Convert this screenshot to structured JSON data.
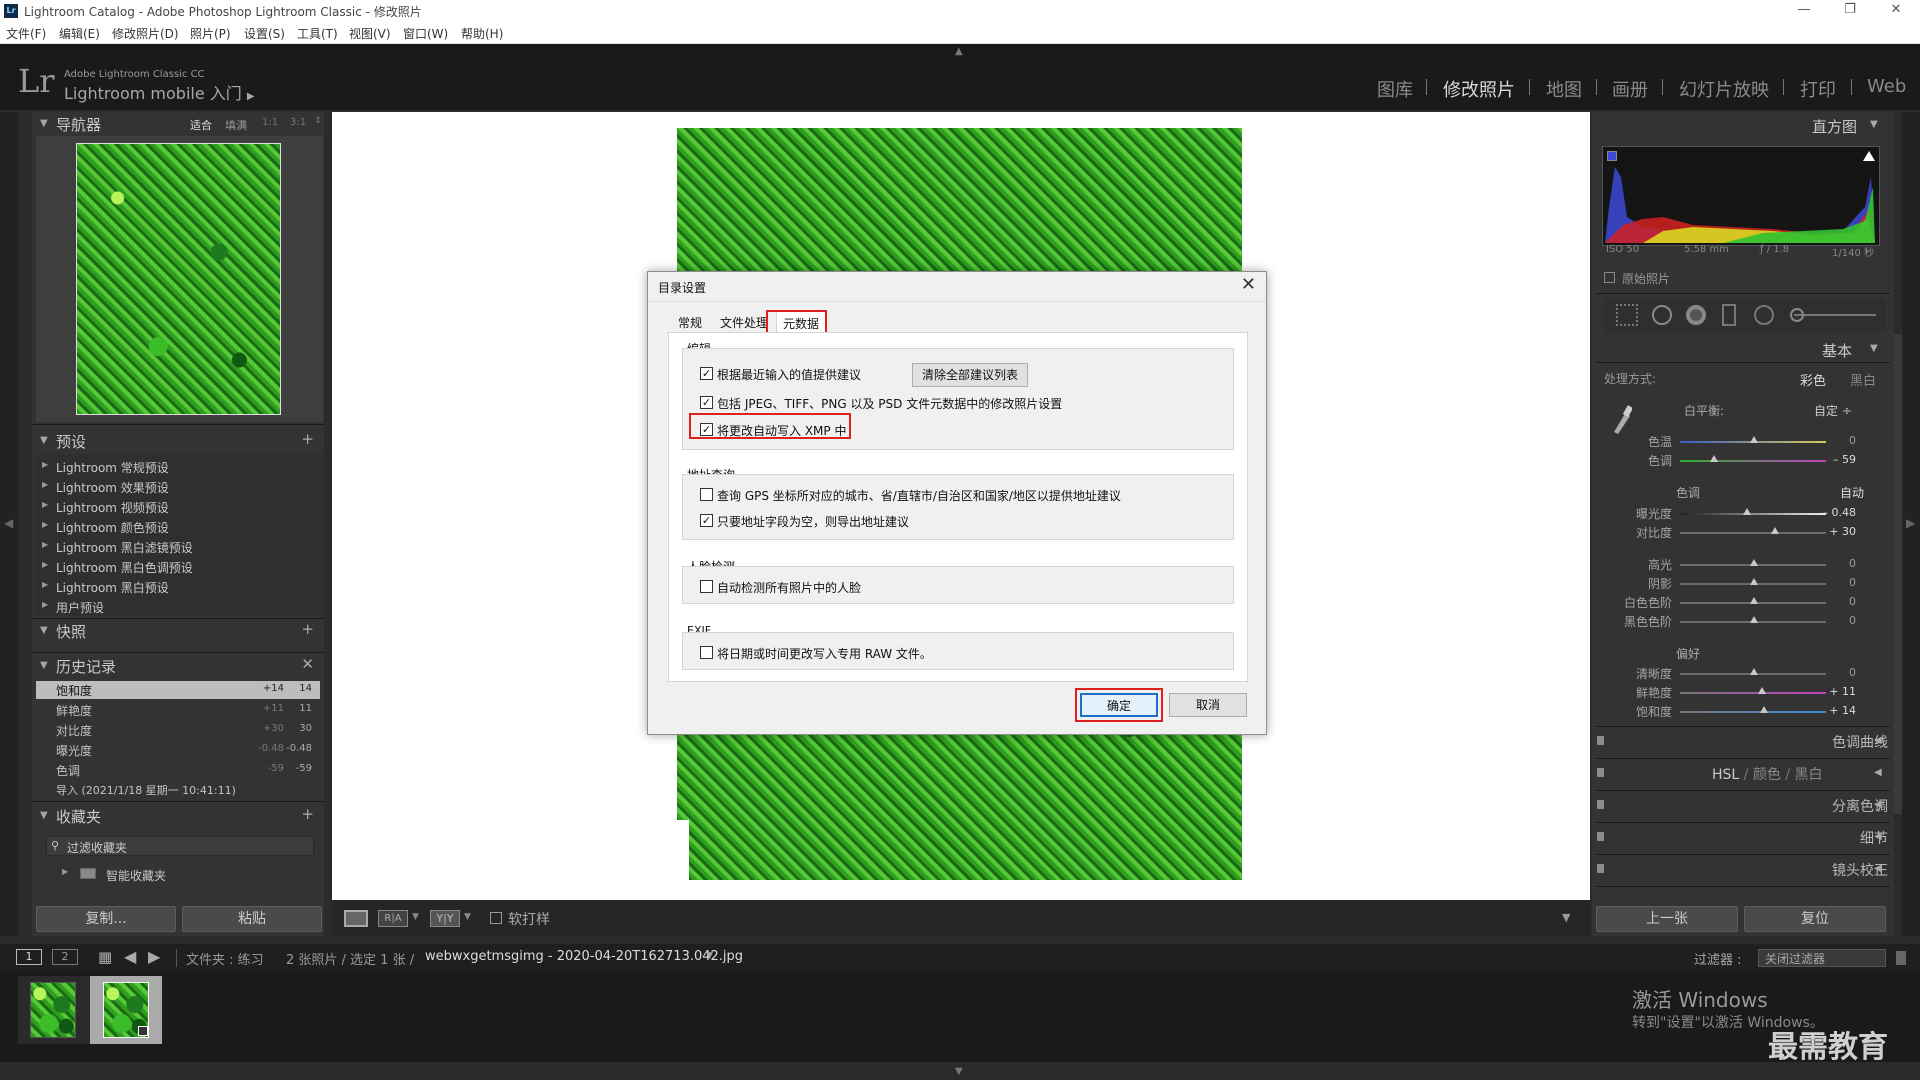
{
  "window": {
    "title": "Lightroom Catalog - Adobe Photoshop Lightroom Classic - 修改照片",
    "app_icon": "Lr"
  },
  "menu": [
    "文件(F)",
    "编辑(E)",
    "修改照片(D)",
    "照片(P)",
    "设置(S)",
    "工具(T)",
    "视图(V)",
    "窗口(W)",
    "帮助(H)"
  ],
  "identity": {
    "logo": "Lr",
    "product": "Adobe Lightroom Classic CC",
    "mobile": "Lightroom mobile 入门"
  },
  "modules": [
    "图库",
    "修改照片",
    "地图",
    "画册",
    "幻灯片放映",
    "打印",
    "Web"
  ],
  "left_panel": {
    "navigator": {
      "title": "导航器",
      "zoom": [
        "适合",
        "填满",
        "1:1",
        "3:1"
      ]
    },
    "presets": {
      "title": "预设",
      "items": [
        "Lightroom 常规预设",
        "Lightroom 效果预设",
        "Lightroom 视频预设",
        "Lightroom 颜色预设",
        "Lightroom 黑白滤镜预设",
        "Lightroom 黑白色调预设",
        "Lightroom 黑白预设",
        "用户预设"
      ]
    },
    "snapshots": {
      "title": "快照"
    },
    "history": {
      "title": "历史记录",
      "items": [
        {
          "name": "饱和度",
          "delta": "+14",
          "value": "14"
        },
        {
          "name": "鲜艳度",
          "delta": "+11",
          "value": "11"
        },
        {
          "name": "对比度",
          "delta": "+30",
          "value": "30"
        },
        {
          "name": "曝光度",
          "delta": "-0.48",
          "value": "-0.48"
        },
        {
          "name": "色调",
          "delta": "-59",
          "value": "-59"
        },
        {
          "name": "导入 (2021/1/18 星期一 10:41:11)",
          "delta": "",
          "value": ""
        }
      ]
    },
    "collections": {
      "title": "收藏夹",
      "filter": "过滤收藏夹",
      "smart": "智能收藏夹"
    },
    "copy_button": "复制...",
    "paste_button": "粘贴"
  },
  "right_panel": {
    "histogram_title": "直方图",
    "exif": [
      "ISO 50",
      "5.58 mm",
      "ƒ / 1.8",
      "1/140 秒"
    ],
    "original_photo": "原始照片",
    "basic_title": "基本",
    "treatment": {
      "label": "处理方式:",
      "color": "彩色",
      "bw": "黑白"
    },
    "wb": {
      "label": "白平衡:",
      "value": "自定 ÷"
    },
    "temp": {
      "label": "色温",
      "value": "0"
    },
    "tint": {
      "label": "色调",
      "value": "– 59"
    },
    "tone": {
      "label": "色调",
      "auto": "自动"
    },
    "exposure": {
      "label": "曝光度",
      "value": "– 0.48"
    },
    "contrast": {
      "label": "对比度",
      "value": "+ 30"
    },
    "highlights": {
      "label": "高光",
      "value": "0"
    },
    "shadows": {
      "label": "阴影",
      "value": "0"
    },
    "whites": {
      "label": "白色色阶",
      "value": "0"
    },
    "blacks": {
      "label": "黑色色阶",
      "value": "0"
    },
    "presence": "偏好",
    "clarity": {
      "label": "清晰度",
      "value": "0"
    },
    "vibrance": {
      "label": "鲜艳度",
      "value": "+ 11"
    },
    "saturation": {
      "label": "饱和度",
      "value": "+ 14"
    },
    "sections": [
      "色调曲线",
      "HSL",
      "颜色",
      "黑白",
      "分离色调",
      "细节",
      "镜头校正"
    ],
    "prev_button": "上一张",
    "reset_button": "复位"
  },
  "toolbar": {
    "soft_proof": "软打样"
  },
  "filmbar": {
    "page1": "1",
    "page2": "2",
    "source": "文件夹 : 练习",
    "count": "2 张照片 / 选定 1 张 /",
    "filename": "webwxgetmsgimg - 2020-04-20T162713.042.jpg",
    "filter_label": "过滤器 :",
    "filter_value": "关闭过滤器"
  },
  "dialog": {
    "title": "目录设置",
    "tabs": [
      "常规",
      "文件处理",
      "元数据"
    ],
    "edit_group": "编辑",
    "opt_suggest": "根据最近输入的值提供建议",
    "clear_button": "清除全部建议列表",
    "opt_include": "包括 JPEG、TIFF、PNG 以及 PSD 文件元数据中的修改照片设置",
    "opt_xmp": "将更改自动写入 XMP 中",
    "address_group": "地址查询",
    "opt_gps": "查询 GPS 坐标所对应的城市、省/直辖市/自治区和国家/地区以提供地址建议",
    "opt_export": "只要地址字段为空，则导出地址建议",
    "face_group": "人脸检测",
    "opt_face": "自动检测所有照片中的人脸",
    "exif_group": "EXIF",
    "opt_exif": "将日期或时间更改写入专用 RAW 文件。",
    "ok": "确定",
    "cancel": "取消"
  },
  "watermark": {
    "activate": "激活 Windows",
    "activate_sub": "转到\"设置\"以激活 Windows。",
    "brand": "最需教育"
  },
  "colors": {
    "highlight_red": "#e02020",
    "leaf_green": "#2f9d1f"
  }
}
